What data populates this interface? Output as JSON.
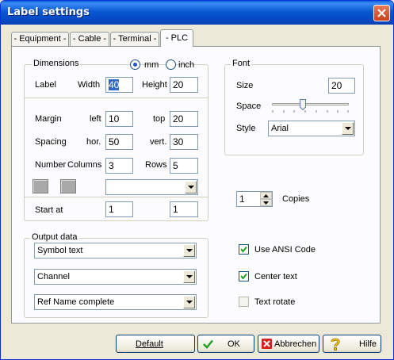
{
  "window": {
    "title": "Label settings"
  },
  "tabs": [
    {
      "label": "- Equipment -"
    },
    {
      "label": "- Cable -"
    },
    {
      "label": "- Terminal -"
    },
    {
      "label": "- PLC"
    }
  ],
  "dimensions": {
    "group_label": "Dimensions",
    "unit_mm": "mm",
    "unit_inch": "inch",
    "selected_unit": "mm",
    "label_caption": "Label",
    "width_caption": "Width",
    "width_value": "40",
    "height_caption": "Height",
    "height_value": "20",
    "margin_caption": "Margin",
    "left_caption": "left",
    "left_value": "10",
    "top_caption": "top",
    "top_value": "20",
    "spacing_caption": "Spacing",
    "hor_caption": "hor.",
    "hor_value": "50",
    "vert_caption": "vert.",
    "vert_value": "30",
    "number_caption": "Number",
    "columns_caption": "Columns",
    "columns_value": "3",
    "rows_caption": "Rows",
    "rows_value": "5",
    "combo_value": "",
    "startat_caption": "Start at",
    "start_col_value": "1",
    "start_row_value": "1"
  },
  "font": {
    "group_label": "Font",
    "size_caption": "Size",
    "size_value": "20",
    "space_caption": "Space",
    "style_caption": "Style",
    "style_value": "Arial"
  },
  "copies": {
    "value": "1",
    "caption": "Copies"
  },
  "output": {
    "group_label": "Output data",
    "select1": "Symbol text",
    "select2": "Channel",
    "select3": "Ref Name complete"
  },
  "options": [
    {
      "label": "Use ANSI Code",
      "checked": true
    },
    {
      "label": "Center text",
      "checked": true
    },
    {
      "label": "Text rotate",
      "checked": false
    }
  ],
  "buttons": {
    "default_label": "Default",
    "ok_label": "OK",
    "cancel_label": "Abbrechen",
    "help_label": "Hilfe"
  },
  "colors": {
    "titlebar": "#0a58d4",
    "close": "#c8411e",
    "check": "#21a121",
    "cancel_icon": "#d42121",
    "help_icon": "#f0c000"
  }
}
